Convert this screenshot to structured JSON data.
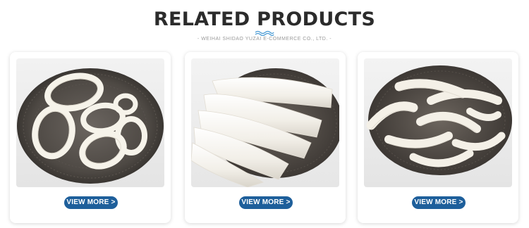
{
  "section": {
    "title": "RELATED PRODUCTS",
    "subtitle": "- WEIHAI SHIDAO YUZAI E-COMMERCE CO., LTD. -"
  },
  "products": [
    {
      "button_label": "VIEW MORE >"
    },
    {
      "button_label": "VIEW MORE >"
    },
    {
      "button_label": "VIEW MORE >"
    }
  ],
  "colors": {
    "button": "#1e5f9b",
    "title": "#2b2b2b",
    "wave": "#4a9bd4"
  },
  "icons": {
    "divider": "wave-icon"
  }
}
